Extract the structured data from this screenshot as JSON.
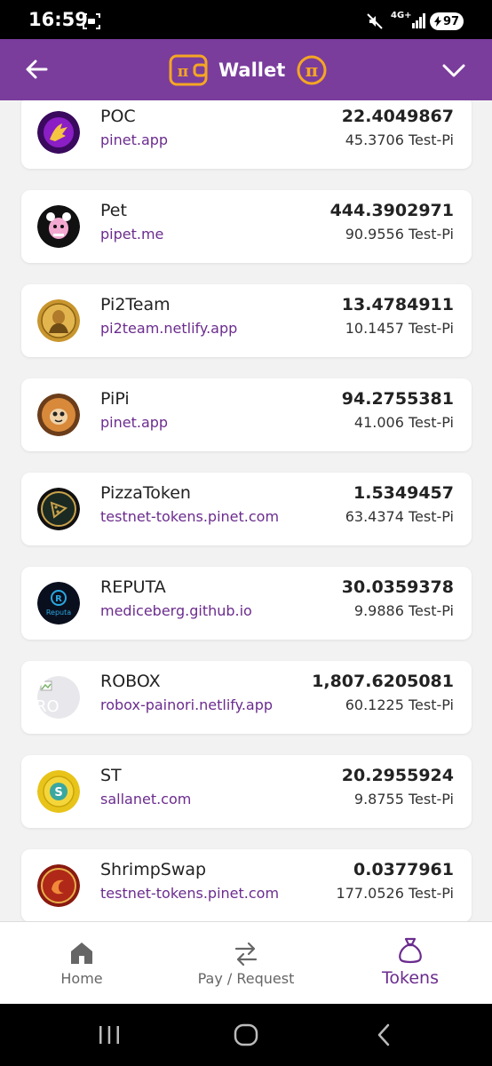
{
  "status": {
    "time": "16:59",
    "network": "4G+",
    "battery": "97"
  },
  "header": {
    "title": "Wallet"
  },
  "tokens": [
    {
      "name": "POC",
      "domain": "pinet.app",
      "amount": "22.4049867",
      "value": "45.3706 Test-Pi"
    },
    {
      "name": "Pet",
      "domain": "pipet.me",
      "amount": "444.3902971",
      "value": "90.9556 Test-Pi"
    },
    {
      "name": "Pi2Team",
      "domain": "pi2team.netlify.app",
      "amount": "13.4784911",
      "value": "10.1457 Test-Pi"
    },
    {
      "name": "PiPi",
      "domain": "pinet.app",
      "amount": "94.2755381",
      "value": "41.006 Test-Pi"
    },
    {
      "name": "PizzaToken",
      "domain": "testnet-tokens.pinet.com",
      "amount": "1.5349457",
      "value": "63.4374 Test-Pi"
    },
    {
      "name": "REPUTA",
      "domain": "mediceberg.github.io",
      "amount": "30.0359378",
      "value": "9.9886 Test-Pi",
      "logo_text": "Reputa"
    },
    {
      "name": "ROBOX",
      "domain": "robox-painori.netlify.app",
      "amount": "1,807.6205081",
      "value": "60.1225 Test-Pi",
      "logo_text": "RO"
    },
    {
      "name": "ST",
      "domain": "sallanet.com",
      "amount": "20.2955924",
      "value": "9.8755 Test-Pi",
      "logo_text": "S"
    },
    {
      "name": "ShrimpSwap",
      "domain": "testnet-tokens.pinet.com",
      "amount": "0.0377961",
      "value": "177.0526 Test-Pi"
    }
  ],
  "nav": {
    "home": "Home",
    "pay": "Pay / Request",
    "tokens": "Tokens"
  },
  "colors": {
    "brand_purple": "#7a3d9c",
    "pi_gold": "#f5a623",
    "active_nav": "#6b2c8e"
  }
}
